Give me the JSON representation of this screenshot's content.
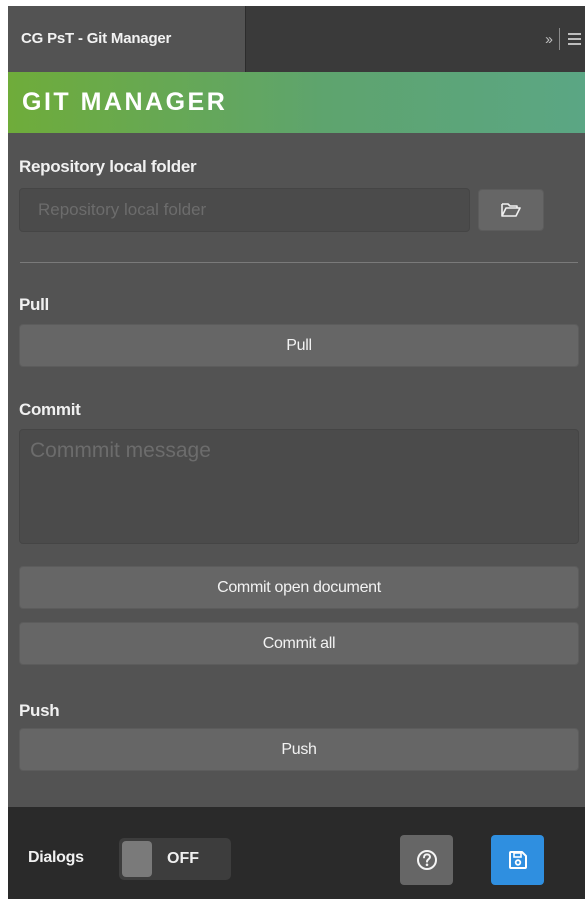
{
  "tab": {
    "title": "CG PsT - Git Manager"
  },
  "header": {
    "title": "GIT MANAGER"
  },
  "repository": {
    "label": "Repository local folder",
    "placeholder": "Repository local folder",
    "value": "",
    "browse_icon": "folder-open-icon"
  },
  "pull": {
    "label": "Pull",
    "button_label": "Pull"
  },
  "commit": {
    "label": "Commit",
    "message_placeholder": "Commmit message",
    "message_value": "",
    "open_document_button_label": "Commit open document",
    "all_button_label": "Commit all"
  },
  "push": {
    "label": "Push",
    "button_label": "Push"
  },
  "footer": {
    "dialogs_label": "Dialogs",
    "dialogs_toggle_state": "OFF",
    "help_icon": "help-icon",
    "save_icon": "save-icon"
  },
  "colors": {
    "panel_bg": "#535353",
    "tabbar_bg": "#3a3a3a",
    "banner_start": "#6fac3a",
    "banner_end": "#5ba684",
    "button_bg": "#666666",
    "footer_bg": "#2a2a2a",
    "save_button_accent": "#2f8fe0"
  }
}
